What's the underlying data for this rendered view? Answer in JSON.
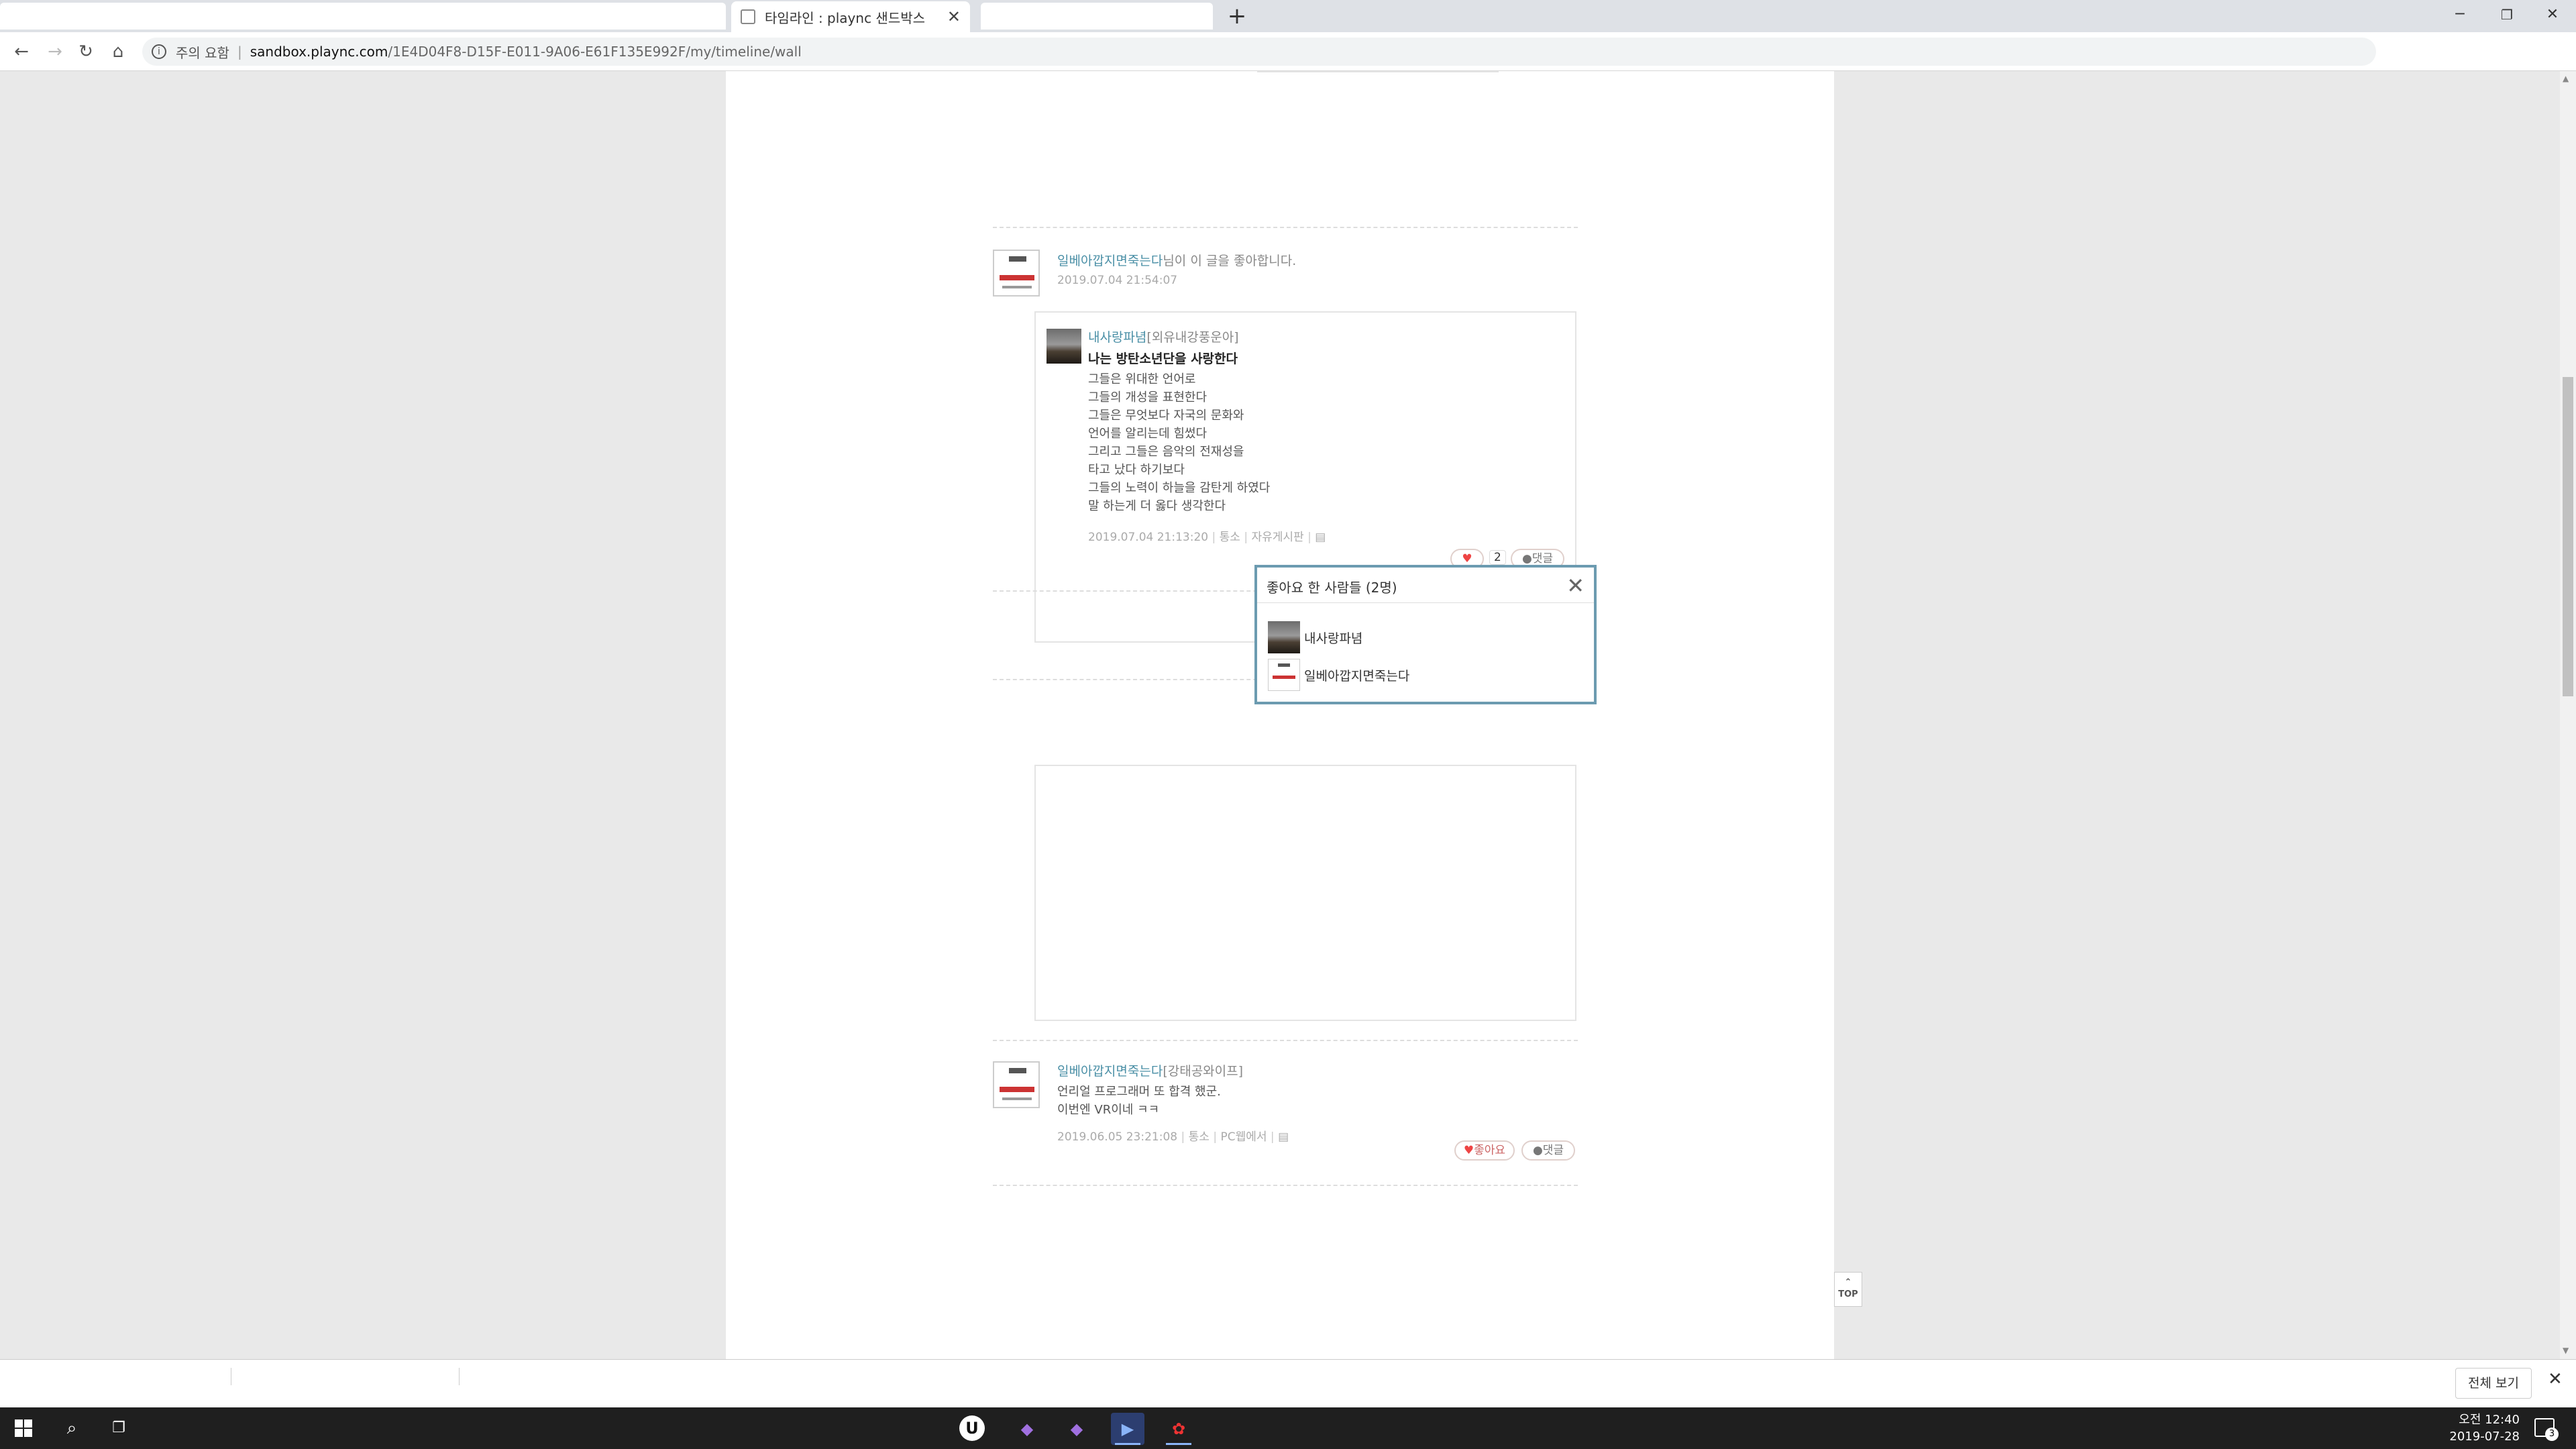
{
  "browser": {
    "tab_title": "타임라인 : plaync 샌드박스",
    "url_warning": "주의 요함",
    "url_host": "sandbox.plaync.com",
    "url_path": "/1E4D04F8-D15F-E011-9A06-E61F135E992F/my/timeline/wall"
  },
  "feed": {
    "like_item": {
      "liker": "일베아깝지면죽는다",
      "like_text": "님이 이 글을 좋아합니다.",
      "liked_at": "2019.07.04 21:54:07",
      "post": {
        "author": "내사랑파념",
        "author_tag": "[외유내강풍운아]",
        "title": "나는 방탄소년단을 사랑한다",
        "lines": [
          "그들은 위대한 언어로",
          "그들의 개성을 표현한다",
          "그들은 무엇보다 자국의 문화와",
          "언어를 알리는데 힘썼다",
          "그리고 그들은 음악의 전재성을",
          "타고 났다 하기보다",
          "그들의 노력이 하늘을 감탄게 하였다",
          "말 하는게 더 옳다 생각한다"
        ],
        "meta_date": "2019.07.04 21:13:20",
        "meta_action": "통소",
        "meta_board": "자유게시판",
        "like_count": "2",
        "comment_label": "댓글"
      }
    },
    "post_item": {
      "author": "일베아깝지면죽는다",
      "author_tag": "[강태공와이프]",
      "lines": [
        "언리얼 프로그래머 또 합격 했군.",
        "이번엔 VR이네 ㅋㅋ"
      ],
      "meta_date": "2019.06.05 23:21:08",
      "meta_action": "통소",
      "meta_source": "PC웹에서",
      "like_label": "좋아요",
      "comment_label": "댓글"
    },
    "top_label": "TOP"
  },
  "likes_popup": {
    "title": "좋아요 한 사람들 (2명)",
    "users": [
      {
        "name": "내사랑파념"
      },
      {
        "name": "일베아깝지면죽는다"
      }
    ]
  },
  "download_bar": {
    "show_all": "전체 보기"
  },
  "taskbar": {
    "time": "오전 12:40",
    "date": "2019-07-28",
    "notifications": "3"
  },
  "colors": {
    "username": "#4a8fa6",
    "popup_border": "#6c9bb0",
    "heart": "#e44444"
  }
}
